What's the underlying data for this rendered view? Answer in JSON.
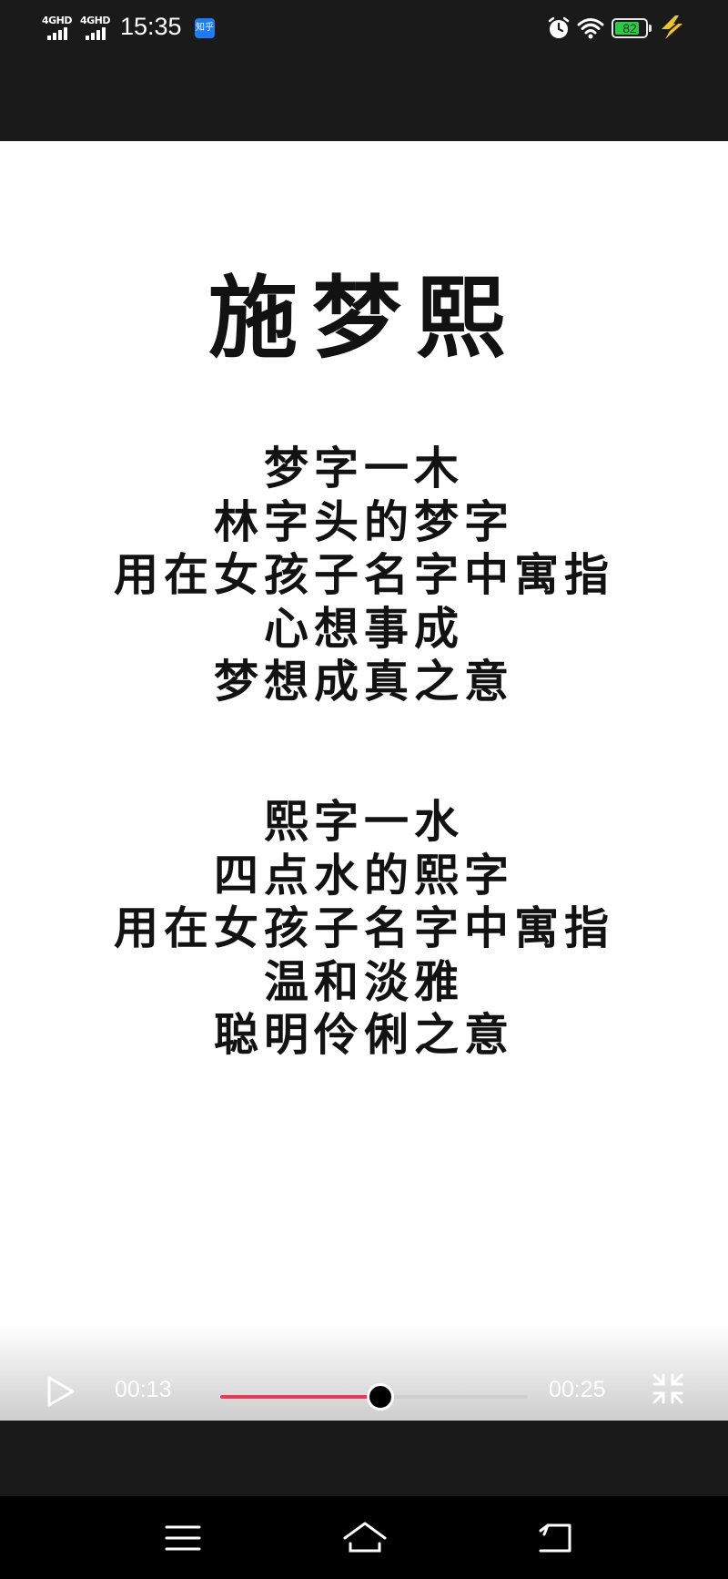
{
  "status_bar": {
    "network_1": "4GHD",
    "network_2": "4GHD",
    "time": "15:35",
    "app_icon": "zhihu-icon",
    "app_icon_text": "知乎",
    "battery_level": "82",
    "icons": [
      "signal-icon",
      "signal-icon",
      "zhihu-icon",
      "alarm-icon",
      "wifi-icon",
      "battery-icon",
      "charge-icon"
    ]
  },
  "video": {
    "title": "施梦熙",
    "stanza_1": [
      "梦字一木",
      "林字头的梦字",
      "用在女孩子名字中寓指",
      "心想事成",
      "梦想成真之意"
    ],
    "stanza_2": [
      "熙字一水",
      "四点水的熙字",
      "用在女孩子名字中寓指",
      "温和淡雅",
      "聪明伶俐之意"
    ]
  },
  "player": {
    "current_time": "00:13",
    "total_time": "00:25",
    "progress": 0.52,
    "progress_color": "#e8395a",
    "play_icon": "play-icon",
    "fullscreen_icon": "exit-fullscreen-icon"
  },
  "nav_bar": {
    "icons": [
      "menu-icon",
      "home-icon",
      "back-icon"
    ]
  }
}
